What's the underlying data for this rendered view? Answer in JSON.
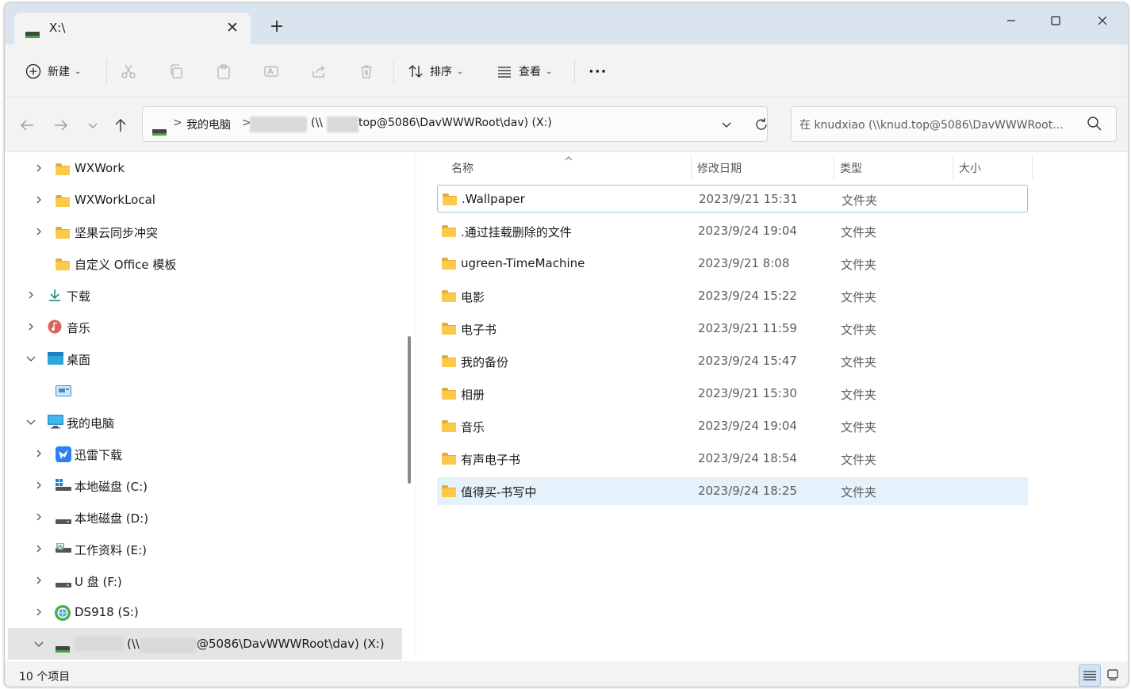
{
  "window": {
    "tab_title": "X:\\",
    "tab_close": "✕",
    "new_tab": "+"
  },
  "toolbar": {
    "new_label": "新建",
    "sort_label": "排序",
    "view_label": "查看",
    "more_label": "···"
  },
  "address": {
    "crumb_pc": "我的电脑",
    "crumb_sep": ">",
    "crumb_drive_prefix": "(\\\\",
    "crumb_drive_suffix": "top@5086\\DavWWWRoot\\dav) (X:)"
  },
  "search": {
    "placeholder": "在 knudxiao (\\\\knud.top@5086\\DavWWWRoot..."
  },
  "nav_tree": [
    {
      "label": "WXWork",
      "icon": "folder-icon"
    },
    {
      "label": "WXWorkLocal",
      "icon": "folder-icon"
    },
    {
      "label": "坚果云同步冲突",
      "icon": "folder-icon"
    },
    {
      "label": "自定义 Office 模板",
      "icon": "folder-icon"
    },
    {
      "label": "下载",
      "icon": "download-icon"
    },
    {
      "label": "音乐",
      "icon": "music-icon"
    },
    {
      "label": "桌面",
      "icon": "desktop-icon"
    },
    {
      "label": "",
      "icon": "desktop-item-icon"
    },
    {
      "label": "我的电脑",
      "icon": "computer-icon"
    },
    {
      "label": "迅雷下载",
      "icon": "thunder-icon"
    },
    {
      "label": "本地磁盘 (C:)",
      "icon": "windows-drive-icon"
    },
    {
      "label": "本地磁盘 (D:)",
      "icon": "drive-icon"
    },
    {
      "label": "工作资料 (E:)",
      "icon": "drive-icon"
    },
    {
      "label": "U 盘 (F:)",
      "icon": "usb-drive-icon"
    },
    {
      "label": "DS918 (S:)",
      "icon": "network-drive-icon"
    },
    {
      "label": "(\\\\",
      "label_suffix": "@5086\\DavWWWRoot\\dav) (X:)",
      "icon": "network-share-icon"
    }
  ],
  "columns": {
    "name": "名称",
    "date": "修改日期",
    "type": "类型",
    "size": "大小"
  },
  "files": [
    {
      "name": ".Wallpaper",
      "date": "2023/9/21 15:31",
      "type": "文件夹"
    },
    {
      "name": ".通过挂载删除的文件",
      "date": "2023/9/24 19:04",
      "type": "文件夹"
    },
    {
      "name": "ugreen-TimeMachine",
      "date": "2023/9/21 8:08",
      "type": "文件夹"
    },
    {
      "name": "电影",
      "date": "2023/9/24 15:22",
      "type": "文件夹"
    },
    {
      "name": "电子书",
      "date": "2023/9/21 11:59",
      "type": "文件夹"
    },
    {
      "name": "我的备份",
      "date": "2023/9/24 15:47",
      "type": "文件夹"
    },
    {
      "name": "相册",
      "date": "2023/9/21 15:30",
      "type": "文件夹"
    },
    {
      "name": "音乐",
      "date": "2023/9/24 19:04",
      "type": "文件夹"
    },
    {
      "name": "有声电子书",
      "date": "2023/9/24 18:54",
      "type": "文件夹"
    },
    {
      "name": "值得买-书写中",
      "date": "2023/9/24 18:25",
      "type": "文件夹"
    }
  ],
  "status": {
    "item_count": "10 个项目"
  },
  "colors": {
    "titlebar": "#d9e4ef",
    "folder": "#fcc94b",
    "selection": "#e5f1fb",
    "focus_border": "#8fc3e8"
  }
}
